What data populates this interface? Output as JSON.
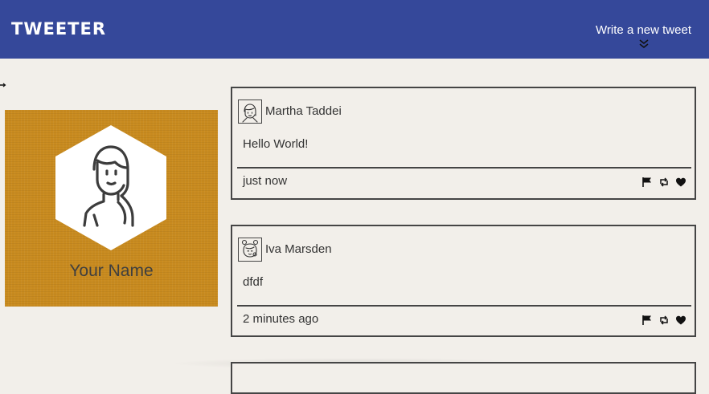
{
  "nav": {
    "brand": "TWEETER",
    "compose_label": "Write a new tweet",
    "compose_icon": "double-chevron-down-icon",
    "color": "#35489a"
  },
  "profile": {
    "name": "Your Name",
    "background_color": "#c98b1f",
    "avatar_icon": "girl-avatar-icon"
  },
  "tweets": [
    {
      "author": "Martha Taddei",
      "text": "Hello World!",
      "time": "just now",
      "avatar_icon": "girl-avatar-icon"
    },
    {
      "author": "Iva Marsden",
      "text": "dfdf",
      "time": "2 minutes ago",
      "avatar_icon": "girl-buns-avatar-icon"
    }
  ],
  "actions": [
    "flag-icon",
    "retweet-icon",
    "heart-icon"
  ]
}
